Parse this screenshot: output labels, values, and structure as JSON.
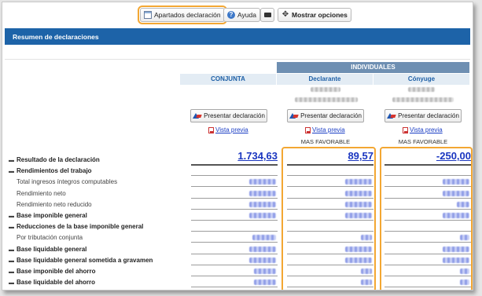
{
  "toolbar": {
    "apartados_label": "Apartados declaración",
    "help_label": "Ayuda",
    "options_label": "Mostrar opciones",
    "icons": [
      "document-icon",
      "help-icon",
      "camera-icon",
      "move-icon"
    ]
  },
  "section": {
    "title": "Resumen de declaraciones"
  },
  "columns": {
    "individuales": "INDIVIDUALES",
    "conjunta": "CONJUNTA",
    "declarante": "Declarante",
    "conyuge": "Cónyuge"
  },
  "actions": {
    "present_label": "Presentar declaración",
    "vista_label": "Vista previa",
    "mas_favorable": "MAS FAVORABLE"
  },
  "result": {
    "conjunta": "1.734,63",
    "declarante": "89,57",
    "conyuge": "-250,00"
  },
  "rows": [
    {
      "label": "Resultado de la declaración",
      "style": "bold"
    },
    {
      "label": "Rendimientos del trabajo",
      "style": "bold"
    },
    {
      "label": "Total ingresos íntegros computables",
      "style": "sub"
    },
    {
      "label": "Rendimiento neto",
      "style": "sub"
    },
    {
      "label": "Rendimiento neto reducido",
      "style": "sub"
    },
    {
      "label": "Base imponible general",
      "style": "bold"
    },
    {
      "label": "Reducciones de la base imponible general",
      "style": "bold"
    },
    {
      "label": "Por tributación conjunta",
      "style": "sub"
    },
    {
      "label": "Base liquidable general",
      "style": "bold"
    },
    {
      "label": "Base liquidable general sometida a gravamen",
      "style": "bold"
    },
    {
      "label": "Base imponible del ahorro",
      "style": "bold"
    },
    {
      "label": "Base liquidable del ahorro",
      "style": "bold"
    }
  ],
  "colors": {
    "accent_blue": "#1d63a8",
    "highlight_orange": "#f3a733",
    "link_blue": "#1a36c0"
  }
}
